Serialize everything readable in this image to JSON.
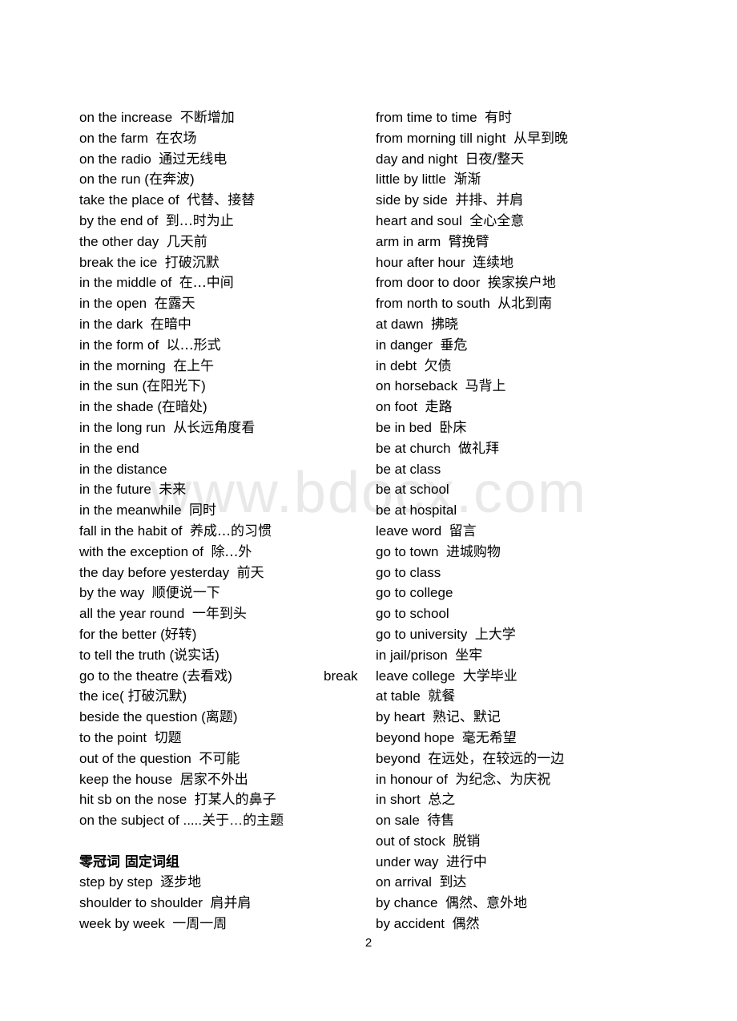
{
  "page": {
    "number": "2",
    "watermark": "www.bdocx.com"
  },
  "left_column": [
    {
      "en": "on the increase",
      "cn": "不断增加"
    },
    {
      "en": "on the farm",
      "cn": "在农场"
    },
    {
      "en": "on the radio",
      "cn": "通过无线电"
    },
    {
      "en": "on the run (在奔波)",
      "cn": ""
    },
    {
      "en": "take the place of",
      "cn": "代替、接替"
    },
    {
      "en": "by the end of",
      "cn": "到…时为止"
    },
    {
      "en": "the other day",
      "cn": "几天前"
    },
    {
      "en": "break the ice",
      "cn": "打破沉默"
    },
    {
      "en": "in the middle of",
      "cn": "在…中间"
    },
    {
      "en": "in the open",
      "cn": "在露天"
    },
    {
      "en": "in the dark",
      "cn": "在暗中"
    },
    {
      "en": "in the form of",
      "cn": "以…形式"
    },
    {
      "en": "in the morning",
      "cn": "在上午"
    },
    {
      "en": "in the sun (在阳光下)",
      "cn": ""
    },
    {
      "en": "in the shade (在暗处)",
      "cn": ""
    },
    {
      "en": "in the long run",
      "cn": "从长远角度看"
    },
    {
      "en": "in the end",
      "cn": ""
    },
    {
      "en": "in the distance",
      "cn": ""
    },
    {
      "en": "in the future",
      "cn": "未来"
    },
    {
      "en": "in the meanwhile",
      "cn": "同时"
    },
    {
      "en": "fall in the habit of",
      "cn": "养成…的习惯"
    },
    {
      "en": "with the exception of",
      "cn": "除…外"
    },
    {
      "en": "the day before yesterday",
      "cn": "前天"
    },
    {
      "en": "by the way",
      "cn": "顺便说一下"
    },
    {
      "en": "all the year round",
      "cn": "一年到头"
    },
    {
      "en": "for the better (好转)",
      "cn": ""
    },
    {
      "en": "to tell the truth (说实话)",
      "cn": ""
    },
    {
      "en": "go to the theatre (去看戏)",
      "cn": "",
      "note": "break"
    },
    {
      "en": "the ice( 打破沉默)",
      "cn": ""
    },
    {
      "en": "beside the question (离题)",
      "cn": ""
    },
    {
      "en": "to the point",
      "cn": "切题"
    },
    {
      "en": "out of the question",
      "cn": "不可能"
    },
    {
      "en": "keep the house",
      "cn": "居家不外出"
    },
    {
      "en": "hit sb on the nose",
      "cn": "打某人的鼻子"
    },
    {
      "en": "on the subject of .....关于…的主题",
      "cn": ""
    },
    {
      "en": "",
      "cn": "",
      "blank": true
    },
    {
      "en": "",
      "cn": "零冠词 固定词组",
      "heading": true
    },
    {
      "en": "step by step",
      "cn": "逐步地"
    },
    {
      "en": "shoulder to shoulder",
      "cn": "肩并肩"
    },
    {
      "en": "week by week",
      "cn": "一周一周"
    }
  ],
  "right_column": [
    {
      "en": "from time to time",
      "cn": "有时"
    },
    {
      "en": "from morning till night",
      "cn": "从早到晚"
    },
    {
      "en": "day and night",
      "cn": "日夜/整天"
    },
    {
      "en": "little by little",
      "cn": "渐渐"
    },
    {
      "en": "side by side",
      "cn": "并排、并肩"
    },
    {
      "en": "heart and soul",
      "cn": "全心全意"
    },
    {
      "en": "arm in arm",
      "cn": "臂挽臂"
    },
    {
      "en": "hour after hour",
      "cn": "连续地"
    },
    {
      "en": "from door to door",
      "cn": "挨家挨户地"
    },
    {
      "en": "from north to south",
      "cn": "从北到南"
    },
    {
      "en": "at dawn",
      "cn": "拂晓"
    },
    {
      "en": "in danger",
      "cn": "垂危"
    },
    {
      "en": "in debt",
      "cn": "欠债"
    },
    {
      "en": "on horseback",
      "cn": "马背上"
    },
    {
      "en": "on foot",
      "cn": "走路"
    },
    {
      "en": "be in bed",
      "cn": "卧床"
    },
    {
      "en": "be at church",
      "cn": "做礼拜"
    },
    {
      "en": "be at class",
      "cn": ""
    },
    {
      "en": "be at school",
      "cn": ""
    },
    {
      "en": "be at hospital",
      "cn": ""
    },
    {
      "en": "leave word",
      "cn": "留言"
    },
    {
      "en": "go to town",
      "cn": "进城购物"
    },
    {
      "en": "go to class",
      "cn": ""
    },
    {
      "en": "go to college",
      "cn": ""
    },
    {
      "en": "go to school",
      "cn": ""
    },
    {
      "en": "go to university",
      "cn": "上大学"
    },
    {
      "en": "in jail/prison",
      "cn": "坐牢"
    },
    {
      "en": "leave college",
      "cn": "大学毕业"
    },
    {
      "en": "at table",
      "cn": "就餐"
    },
    {
      "en": "by heart",
      "cn": "熟记、默记"
    },
    {
      "en": "beyond hope",
      "cn": "毫无希望"
    },
    {
      "en": "beyond",
      "cn": "在远处，在较远的一边"
    },
    {
      "en": "in honour of",
      "cn": "为纪念、为庆祝"
    },
    {
      "en": "in short",
      "cn": "总之"
    },
    {
      "en": "on sale",
      "cn": "待售"
    },
    {
      "en": "out of stock",
      "cn": "脱销"
    },
    {
      "en": "under way",
      "cn": "进行中"
    },
    {
      "en": "on arrival",
      "cn": "到达"
    },
    {
      "en": "by chance",
      "cn": "偶然、意外地"
    },
    {
      "en": "by accident",
      "cn": "偶然"
    }
  ]
}
